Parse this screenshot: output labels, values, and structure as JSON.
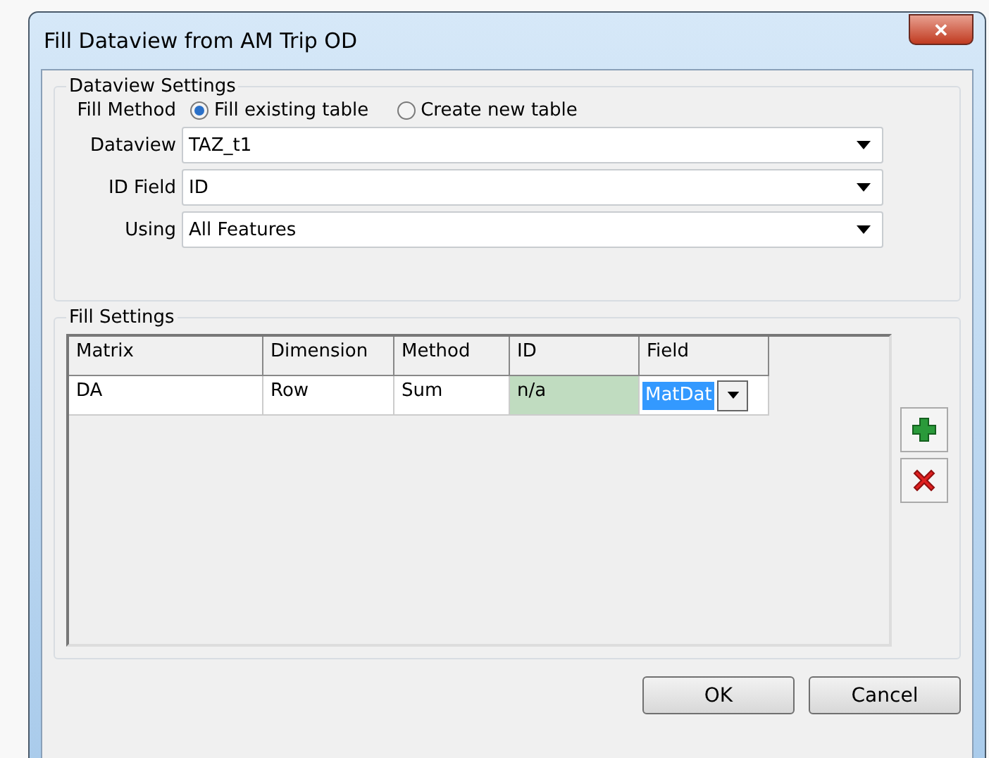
{
  "window": {
    "title": "Fill Dataview from AM Trip OD",
    "close": "✕"
  },
  "dataview_settings": {
    "title": "Dataview Settings",
    "fill_method": {
      "label": "Fill Method",
      "options": [
        {
          "label": "Fill existing table",
          "selected": true
        },
        {
          "label": "Create new table",
          "selected": false
        }
      ]
    },
    "fields": [
      {
        "label": "Dataview",
        "value": "TAZ_t1"
      },
      {
        "label": "ID Field",
        "value": "ID"
      },
      {
        "label": "Using",
        "value": "All Features"
      }
    ]
  },
  "fill_settings": {
    "title": "Fill Settings",
    "columns": [
      "Matrix",
      "Dimension",
      "Method",
      "ID",
      "Field"
    ],
    "rows": [
      {
        "cells": [
          {
            "text": "DA",
            "kind": "plain",
            "selected": false
          },
          {
            "text": "Row",
            "kind": "plain",
            "selected": false
          },
          {
            "text": "Sum",
            "kind": "plain",
            "selected": false
          },
          {
            "text": "n/a",
            "kind": "shaded",
            "selected": false
          },
          {
            "text": "MatDat",
            "kind": "combo",
            "selected": true
          }
        ]
      }
    ]
  },
  "buttons": [
    "OK",
    "Cancel"
  ]
}
